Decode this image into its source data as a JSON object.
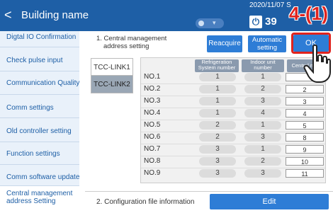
{
  "header": {
    "back_label": "<",
    "title": "Building name",
    "datetime": "2020/11/07 S",
    "count": "39",
    "power_icon": "power-icon"
  },
  "sidebar": {
    "items": [
      {
        "label": "Digtal IO Confirmation"
      },
      {
        "label": "Check pulse input"
      },
      {
        "label": "Communication Quality"
      },
      {
        "label": "Comm settings"
      },
      {
        "label": "Old controller setting"
      },
      {
        "label": "Function settings"
      },
      {
        "label": "Comm software update"
      },
      {
        "label": "Central management address Setting"
      }
    ]
  },
  "section1": {
    "title_line1": "1. Central management",
    "title_line2": "address setting",
    "reacquire": "Reacquire",
    "automatic_line1": "Automatic",
    "automatic_line2": "setting",
    "ok": "OK"
  },
  "tabs": [
    {
      "label": "TCC-LINK1"
    },
    {
      "label": "TCC-LINK2"
    }
  ],
  "table": {
    "headers": {
      "refrig_line1": "Refrigeration",
      "refrig_line2": "System number",
      "indoor_line1": "Indoor unit",
      "indoor_line2": "number",
      "central": "Central man"
    },
    "rows": [
      {
        "no": "NO.1",
        "refrig": "1",
        "indoor": "1",
        "addr": ""
      },
      {
        "no": "NO.2",
        "refrig": "1",
        "indoor": "2",
        "addr": "2"
      },
      {
        "no": "NO.3",
        "refrig": "1",
        "indoor": "3",
        "addr": "3"
      },
      {
        "no": "NO.4",
        "refrig": "1",
        "indoor": "4",
        "addr": "4"
      },
      {
        "no": "NO.5",
        "refrig": "2",
        "indoor": "1",
        "addr": "5"
      },
      {
        "no": "NO.6",
        "refrig": "2",
        "indoor": "3",
        "addr": "8"
      },
      {
        "no": "NO.7",
        "refrig": "3",
        "indoor": "1",
        "addr": "9"
      },
      {
        "no": "NO.8",
        "refrig": "3",
        "indoor": "2",
        "addr": "10"
      },
      {
        "no": "NO.9",
        "refrig": "3",
        "indoor": "3",
        "addr": "11"
      }
    ]
  },
  "section2": {
    "title": "2. Configuration file information",
    "edit": "Edit"
  },
  "annotation": {
    "label": "4-(1)",
    "color": "#e0231e"
  }
}
